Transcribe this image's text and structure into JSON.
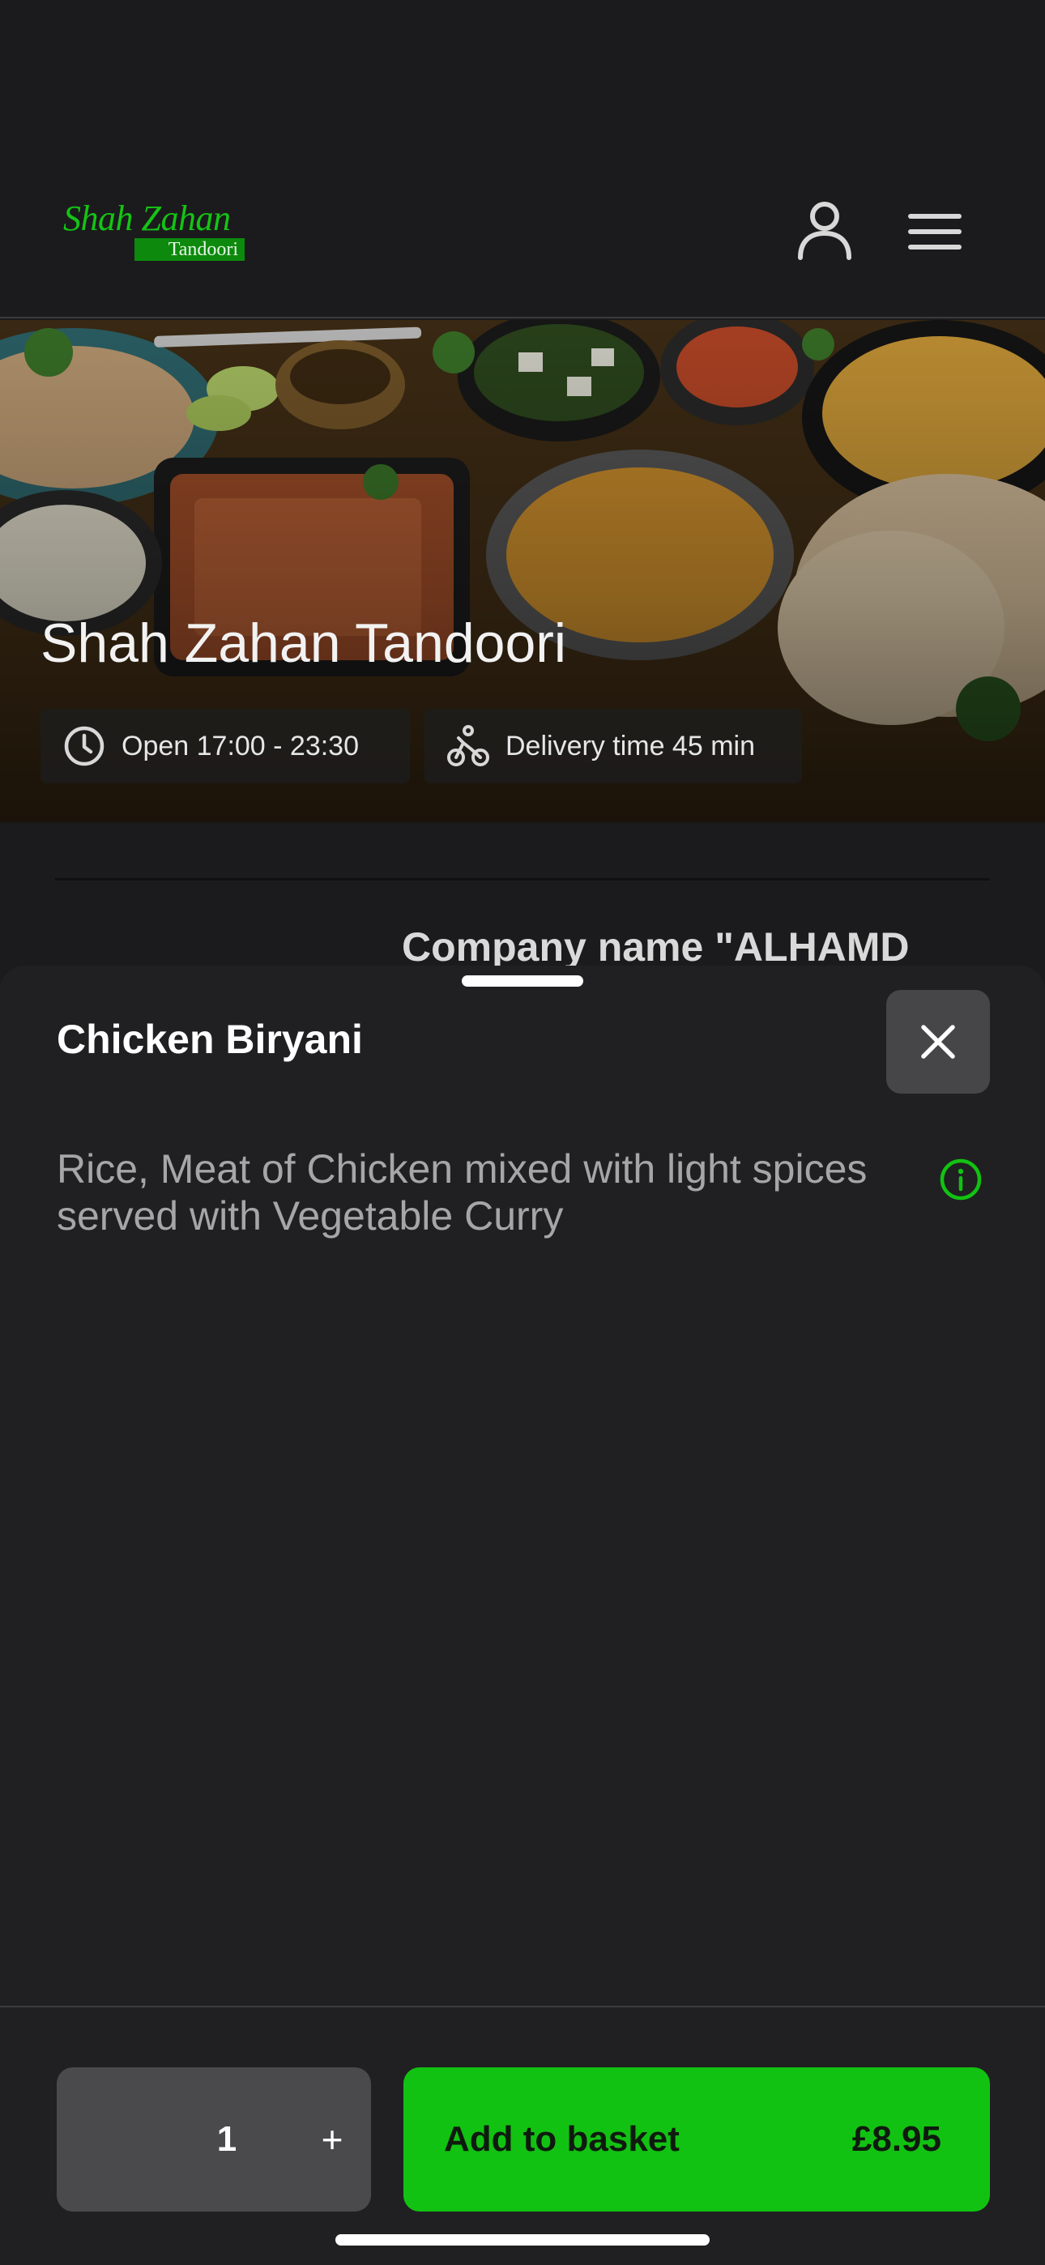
{
  "header": {
    "logo_main": "Shah Zahan",
    "logo_sub": "Tandoori",
    "user_icon": "user-icon",
    "menu_icon": "hamburger-menu-icon"
  },
  "hero": {
    "title": "Shah Zahan Tandoori",
    "opening_hours": "Open 17:00 - 23:30",
    "delivery_time": "Delivery time 45 min",
    "clock_icon": "clock-icon",
    "delivery_icon": "bicycle-courier-icon"
  },
  "page": {
    "company_name": "Company name \"ALHAMD"
  },
  "item_sheet": {
    "title": "Chicken Biryani",
    "description": "Rice, Meat of Chicken mixed with light spices served with Vegetable Curry",
    "close_icon": "close-icon",
    "info_icon": "info-icon"
  },
  "footer": {
    "quantity": "1",
    "increment_label": "+",
    "add_label": "Add to basket",
    "price": "£8.95"
  },
  "colors": {
    "background": "#1b1b1d",
    "sheet": "#202022",
    "accent_green": "#12c212",
    "stepper": "#4a4a4c"
  }
}
